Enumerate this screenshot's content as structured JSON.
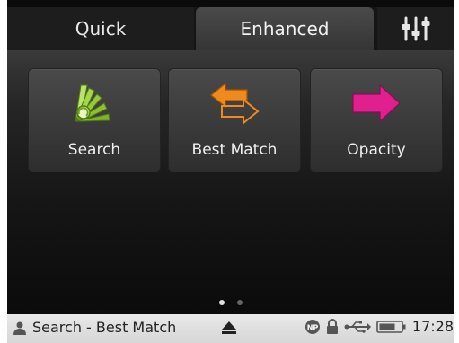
{
  "tabs": {
    "quick": "Quick",
    "enhanced": "Enhanced",
    "settings_icon": "sliders-icon"
  },
  "tiles": [
    {
      "label": "Search",
      "icon": "search-fan-icon"
    },
    {
      "label": "Best Match",
      "icon": "swap-arrows-icon"
    },
    {
      "label": "Opacity",
      "icon": "opacity-arrow-icon"
    }
  ],
  "pager": {
    "pages": 2,
    "active": 1
  },
  "status": {
    "mode": "Search - Best Match",
    "time": "17:28",
    "icons": [
      "user-icon",
      "eject-icon",
      "np-icon",
      "lock-icon",
      "usb-icon",
      "battery-icon"
    ]
  },
  "colors": {
    "search_icon": "#a8d64a",
    "best_match_icon": "#f08a1c",
    "opacity_icon": "#e0208f"
  }
}
